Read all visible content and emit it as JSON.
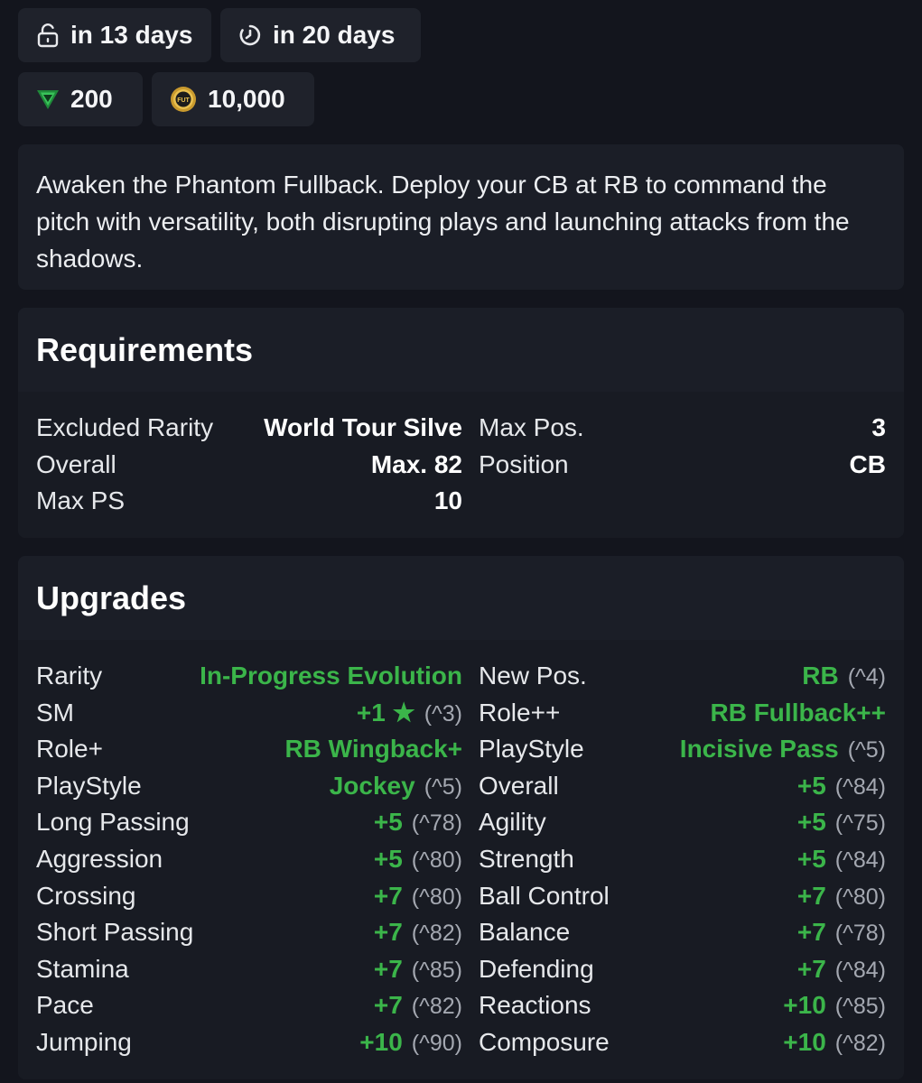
{
  "timers": {
    "unlock": "in 13 days",
    "expires": "in 20 days"
  },
  "costs": {
    "points": "200",
    "coins": "10,000"
  },
  "description": "Awaken the Phantom Fullback. Deploy your CB at RB to command the pitch with versatility, both disrupting plays and launching attacks from the shadows.",
  "requirements": {
    "title": "Requirements",
    "left": [
      {
        "label": "Excluded Rarity",
        "value": "World Tour Silve"
      },
      {
        "label": "Overall",
        "value": "Max. 82"
      },
      {
        "label": "Max PS",
        "value": "10"
      }
    ],
    "right": [
      {
        "label": "Max Pos.",
        "value": "3"
      },
      {
        "label": "Position",
        "value": "CB"
      }
    ]
  },
  "upgrades": {
    "title": "Upgrades",
    "left": [
      {
        "label": "Rarity",
        "value": "In-Progress Evolution",
        "cap": ""
      },
      {
        "label": "SM",
        "value": "+1 ★",
        "cap": "(^3)"
      },
      {
        "label": "Role+",
        "value": "RB Wingback+",
        "cap": ""
      },
      {
        "label": "PlayStyle",
        "value": "Jockey",
        "cap": "(^5)"
      },
      {
        "label": "Long Passing",
        "value": "+5",
        "cap": "(^78)"
      },
      {
        "label": "Aggression",
        "value": "+5",
        "cap": "(^80)"
      },
      {
        "label": "Crossing",
        "value": "+7",
        "cap": "(^80)"
      },
      {
        "label": "Short Passing",
        "value": "+7",
        "cap": "(^82)"
      },
      {
        "label": "Stamina",
        "value": "+7",
        "cap": "(^85)"
      },
      {
        "label": "Pace",
        "value": "+7",
        "cap": "(^82)"
      },
      {
        "label": "Jumping",
        "value": "+10",
        "cap": "(^90)"
      }
    ],
    "right": [
      {
        "label": "New Pos.",
        "value": "RB",
        "cap": "(^4)"
      },
      {
        "label": "Role++",
        "value": "RB Fullback++",
        "cap": ""
      },
      {
        "label": "PlayStyle",
        "value": "Incisive Pass",
        "cap": "(^5)"
      },
      {
        "label": "Overall",
        "value": "+5",
        "cap": "(^84)"
      },
      {
        "label": "Agility",
        "value": "+5",
        "cap": "(^75)"
      },
      {
        "label": "Strength",
        "value": "+5",
        "cap": "(^84)"
      },
      {
        "label": "Ball Control",
        "value": "+7",
        "cap": "(^80)"
      },
      {
        "label": "Balance",
        "value": "+7",
        "cap": "(^78)"
      },
      {
        "label": "Defending",
        "value": "+7",
        "cap": "(^84)"
      },
      {
        "label": "Reactions",
        "value": "+10",
        "cap": "(^85)"
      },
      {
        "label": "Composure",
        "value": "+10",
        "cap": "(^82)"
      }
    ]
  },
  "colors": {
    "background": "#13151d",
    "panel": "#1b1e27",
    "accent_green": "#3bb54a",
    "cap_gray": "#a4a8b1"
  },
  "icons": {
    "unlock": "unlock-icon",
    "timer": "timer-icon",
    "points": "fut-points-icon",
    "coins": "fut-coins-icon"
  }
}
